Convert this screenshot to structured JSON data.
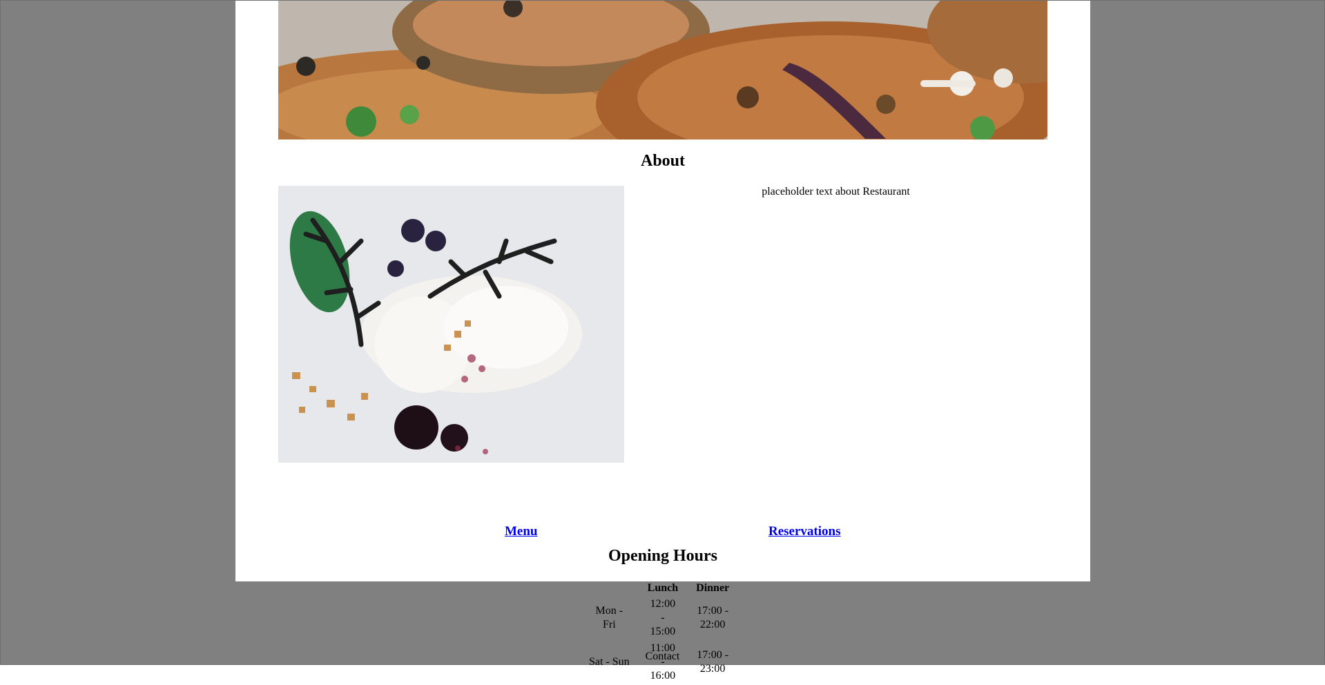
{
  "images": {
    "hero": "mushroom-dish-on-wooden-boards",
    "about": "dessert-plate-with-black-coral-garnish"
  },
  "about": {
    "title": "About",
    "text": "placeholder text about Restaurant"
  },
  "nav": {
    "menu_label": "Menu",
    "reservations_label": "Reservations"
  },
  "hours": {
    "title": "Opening Hours",
    "columns": [
      "",
      "Lunch",
      "Dinner"
    ],
    "rows": [
      {
        "day": "Mon - Fri",
        "lunch": "12:00 - 15:00",
        "dinner": "17:00 - 22:00"
      },
      {
        "day": "Sat - Sun",
        "lunch": "11:00 - 16:00",
        "dinner": "17:00 - 23:00"
      }
    ]
  },
  "contact": {
    "label": "Contact"
  },
  "colors": {
    "backdrop": "#808080",
    "panel": "#ffffff",
    "link": "#0000ee"
  }
}
